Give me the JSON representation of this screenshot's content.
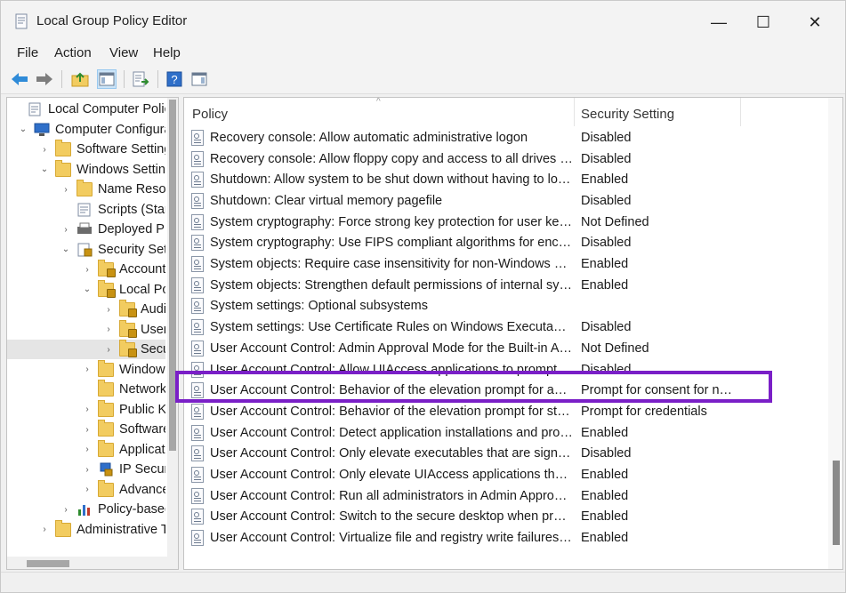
{
  "window": {
    "title": "Local Group Policy Editor",
    "controls": {
      "minimize": "—",
      "maximize": "☐",
      "close": "✕"
    }
  },
  "menu": [
    "File",
    "Action",
    "View",
    "Help"
  ],
  "toolbar": {
    "icons": [
      "back-arrow-icon",
      "forward-arrow-icon",
      "up-folder-icon",
      "show-hide-tree-icon",
      "export-list-icon",
      "help-icon",
      "properties-pane-icon"
    ]
  },
  "tree": {
    "items": [
      {
        "label": "Local Computer Policy",
        "level": 0,
        "chevron": "",
        "icon": "document"
      },
      {
        "label": "Computer Configuration",
        "level": 1,
        "chevron": "v",
        "icon": "computer"
      },
      {
        "label": "Software Settings",
        "level": 2,
        "chevron": ">",
        "icon": "folder"
      },
      {
        "label": "Windows Settings",
        "level": 2,
        "chevron": "v",
        "icon": "folder"
      },
      {
        "label": "Name Resolution Policy",
        "level": 3,
        "chevron": ">",
        "icon": "folder"
      },
      {
        "label": "Scripts (Startup/Shutdown)",
        "level": 3,
        "chevron": "",
        "icon": "script"
      },
      {
        "label": "Deployed Printers",
        "level": 3,
        "chevron": ">",
        "icon": "printer"
      },
      {
        "label": "Security Settings",
        "level": 3,
        "chevron": "v",
        "icon": "security"
      },
      {
        "label": "Account Policies",
        "level": 4,
        "chevron": ">",
        "icon": "lockfolder"
      },
      {
        "label": "Local Policies",
        "level": 4,
        "chevron": "v",
        "icon": "lockfolder"
      },
      {
        "label": "Audit Policy",
        "level": 5,
        "chevron": ">",
        "icon": "lockfolder"
      },
      {
        "label": "User Rights Assignment",
        "level": 5,
        "chevron": ">",
        "icon": "lockfolder"
      },
      {
        "label": "Security Options",
        "level": 5,
        "chevron": ">",
        "icon": "lockfolder",
        "selected": true
      },
      {
        "label": "Windows Defender Firewall",
        "level": 4,
        "chevron": ">",
        "icon": "folder"
      },
      {
        "label": "Network List Manager Policies",
        "level": 4,
        "chevron": "",
        "icon": "folder"
      },
      {
        "label": "Public Key Policies",
        "level": 4,
        "chevron": ">",
        "icon": "folder"
      },
      {
        "label": "Software Restriction Policies",
        "level": 4,
        "chevron": ">",
        "icon": "folder"
      },
      {
        "label": "Application Control Policies",
        "level": 4,
        "chevron": ">",
        "icon": "folder"
      },
      {
        "label": "IP Security Policies on Local Computer",
        "level": 4,
        "chevron": ">",
        "icon": "ipsec"
      },
      {
        "label": "Advanced Audit Policy Configuration",
        "level": 4,
        "chevron": ">",
        "icon": "folder"
      },
      {
        "label": "Policy-based QoS",
        "level": 3,
        "chevron": ">",
        "icon": "chart"
      },
      {
        "label": "Administrative Templates",
        "level": 2,
        "chevron": ">",
        "icon": "folder"
      }
    ]
  },
  "list": {
    "headers": {
      "policy": "Policy",
      "setting": "Security Setting"
    },
    "rows": [
      {
        "policy": "Recovery console: Allow automatic administrative logon",
        "setting": "Disabled"
      },
      {
        "policy": "Recovery console: Allow floppy copy and access to all drives and all folders",
        "setting": "Disabled"
      },
      {
        "policy": "Shutdown: Allow system to be shut down without having to log on",
        "setting": "Enabled"
      },
      {
        "policy": "Shutdown: Clear virtual memory pagefile",
        "setting": "Disabled"
      },
      {
        "policy": "System cryptography: Force strong key protection for user keys stored on the computer",
        "setting": "Not Defined"
      },
      {
        "policy": "System cryptography: Use FIPS compliant algorithms for encryption, hashing, and signing",
        "setting": "Disabled"
      },
      {
        "policy": "System objects: Require case insensitivity for non-Windows subsystems",
        "setting": "Enabled"
      },
      {
        "policy": "System objects: Strengthen default permissions of internal system objects",
        "setting": "Enabled"
      },
      {
        "policy": "System settings: Optional subsystems",
        "setting": ""
      },
      {
        "policy": "System settings: Use Certificate Rules on Windows Executables for Software Restriction Policies",
        "setting": "Disabled"
      },
      {
        "policy": "User Account Control: Admin Approval Mode for the Built-in Administrator account",
        "setting": "Not Defined"
      },
      {
        "policy": "User Account Control: Allow UIAccess applications to prompt for elevation without using the secure desktop",
        "setting": "Disabled"
      },
      {
        "policy": "User Account Control: Behavior of the elevation prompt for administrators in Admin Approval Mode",
        "setting": "Prompt for consent for non-Windows binaries",
        "highlighted": true
      },
      {
        "policy": "User Account Control: Behavior of the elevation prompt for standard users",
        "setting": "Prompt for credentials"
      },
      {
        "policy": "User Account Control: Detect application installations and prompt for elevation",
        "setting": "Enabled"
      },
      {
        "policy": "User Account Control: Only elevate executables that are signed and validated",
        "setting": "Disabled"
      },
      {
        "policy": "User Account Control: Only elevate UIAccess applications that are installed in secure locations",
        "setting": "Enabled"
      },
      {
        "policy": "User Account Control: Run all administrators in Admin Approval Mode",
        "setting": "Enabled"
      },
      {
        "policy": "User Account Control: Switch to the secure desktop when prompting for elevation",
        "setting": "Enabled"
      },
      {
        "policy": "User Account Control: Virtualize file and registry write failures to per-user locations",
        "setting": "Enabled"
      }
    ]
  },
  "colors": {
    "highlight_border": "#7a1fc7",
    "selected_bg": "#e5e5e5"
  }
}
